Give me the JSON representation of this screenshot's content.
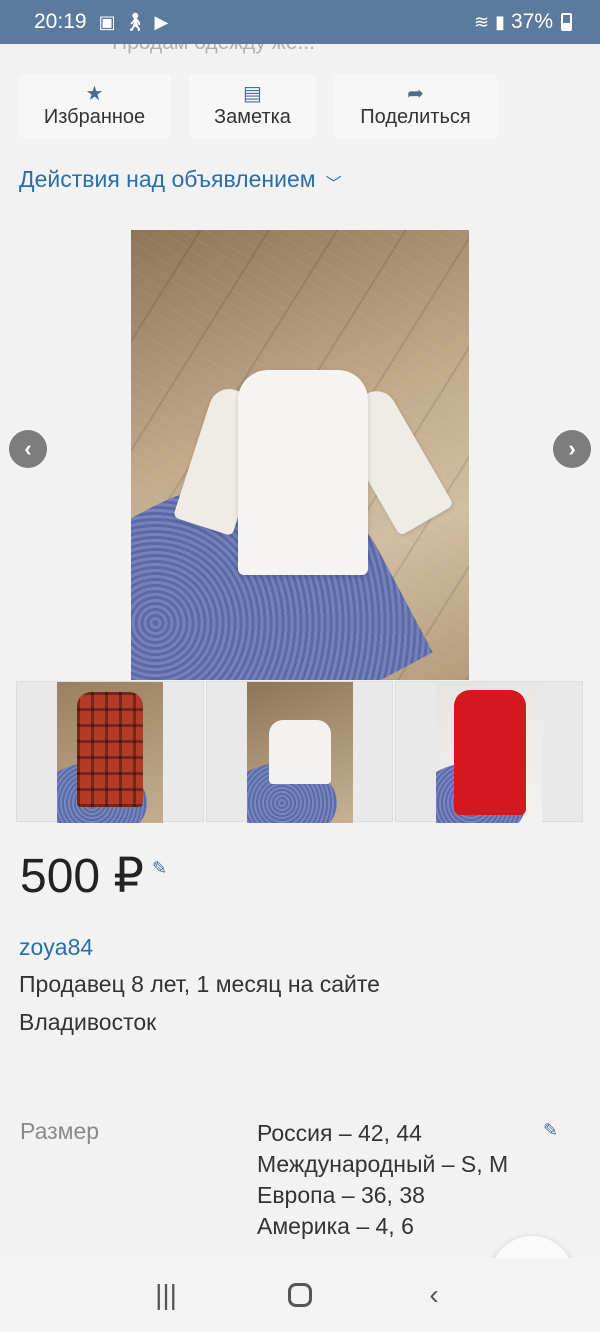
{
  "status_bar": {
    "time": "20:19",
    "battery": "37%"
  },
  "header": {
    "title_fragment": "Продам одежду же..."
  },
  "actions": {
    "favorite_label": "Избранное",
    "note_label": "Заметка",
    "share_label": "Поделиться"
  },
  "ad_actions": {
    "label": "Действия над объявлением"
  },
  "listing": {
    "price": "500 ₽",
    "seller": {
      "name": "zoya84",
      "since": "Продавец 8 лет, 1 месяц на сайте",
      "city": "Владивосток"
    },
    "size": {
      "label": "Размер",
      "values": [
        "Россия – 42, 44",
        "Международный – S, M",
        "Европа – 36, 38",
        "Америка – 4, 6"
      ]
    }
  },
  "icons": {
    "favorite": "star-icon",
    "note": "note-icon",
    "share": "share-icon",
    "edit": "pencil-icon"
  },
  "colors": {
    "status_bar": "#5b7a9c",
    "link": "#2b6ea8",
    "icon_accent": "#4a6d93"
  }
}
